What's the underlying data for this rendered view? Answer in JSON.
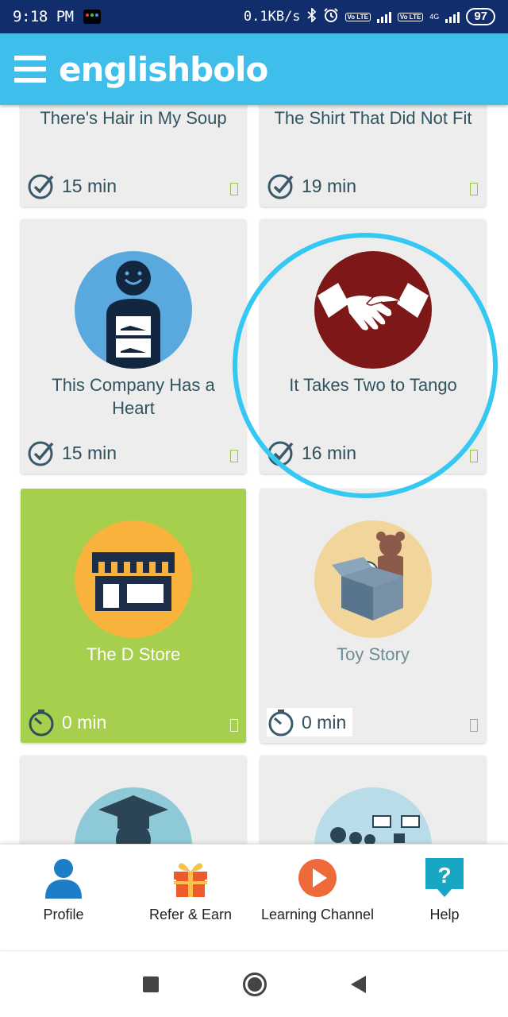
{
  "status_bar": {
    "time": "9:18 PM",
    "network_speed": "0.1KB/s",
    "volte1": "Vo LTE",
    "volte2": "Vo LTE",
    "network_type": "4G",
    "battery": "97"
  },
  "app_bar": {
    "logo": "englishbolo"
  },
  "cards": [
    {
      "title": "There's Hair in My Soup",
      "duration": "15 min"
    },
    {
      "title": "The Shirt That Did Not Fit",
      "duration": "19 min"
    },
    {
      "title": "This Company Has a Heart",
      "duration": "15 min"
    },
    {
      "title": "It Takes Two to Tango",
      "duration": "16 min"
    },
    {
      "title": "The D Store",
      "duration": "0 min"
    },
    {
      "title": "Toy Story",
      "duration": "0 min"
    },
    {
      "title": "",
      "duration": ""
    },
    {
      "title": "",
      "duration": ""
    }
  ],
  "bottom_nav": [
    {
      "label": "Profile",
      "icon": "person-icon",
      "color": "#1e7dc7"
    },
    {
      "label": "Refer & Earn",
      "icon": "gift-icon",
      "color": "#ee5a2a"
    },
    {
      "label": "Learning Channel",
      "icon": "play-icon",
      "color": "#ee6a3a"
    },
    {
      "label": "Help",
      "icon": "help-icon",
      "color": "#17a6c4"
    }
  ],
  "colors": {
    "status_bar": "#122d6b",
    "app_bar": "#3fbdeb",
    "card_bg": "#eeeded",
    "card_active": "#a5cf4c",
    "highlight_ring": "#34c8f2"
  }
}
